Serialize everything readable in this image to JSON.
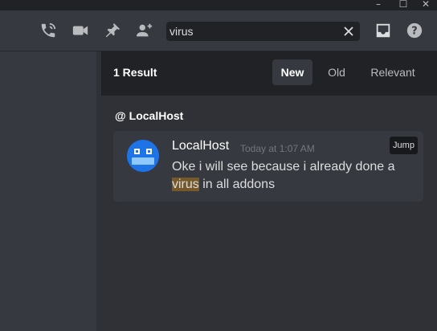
{
  "window_controls": {
    "minimize": "–",
    "maximize": "☐",
    "close": "✕"
  },
  "toolbar": {
    "icons": [
      "call-icon",
      "video-icon",
      "pin-icon",
      "add-user-icon",
      "inbox-icon",
      "help-icon"
    ],
    "search": {
      "value": "virus",
      "placeholder": "Search"
    }
  },
  "results": {
    "count_label": "1 Result",
    "sort_tabs": [
      {
        "label": "New",
        "active": true
      },
      {
        "label": "Old",
        "active": false
      },
      {
        "label": "Relevant",
        "active": false
      }
    ],
    "channel": {
      "prefix": "@",
      "name": "LocalHost"
    },
    "message": {
      "author": "LocalHost",
      "timestamp": "Today at 1:07 AM",
      "jump_label": "Jump",
      "text_before": "Oke i will see because i already done a ",
      "highlight": "virus",
      "text_after": " in all addons"
    }
  },
  "colors": {
    "background": "#36393f",
    "header": "#202225",
    "results_bg": "#2f3136",
    "avatar": "#1e73e6",
    "highlight": "#76592b"
  }
}
